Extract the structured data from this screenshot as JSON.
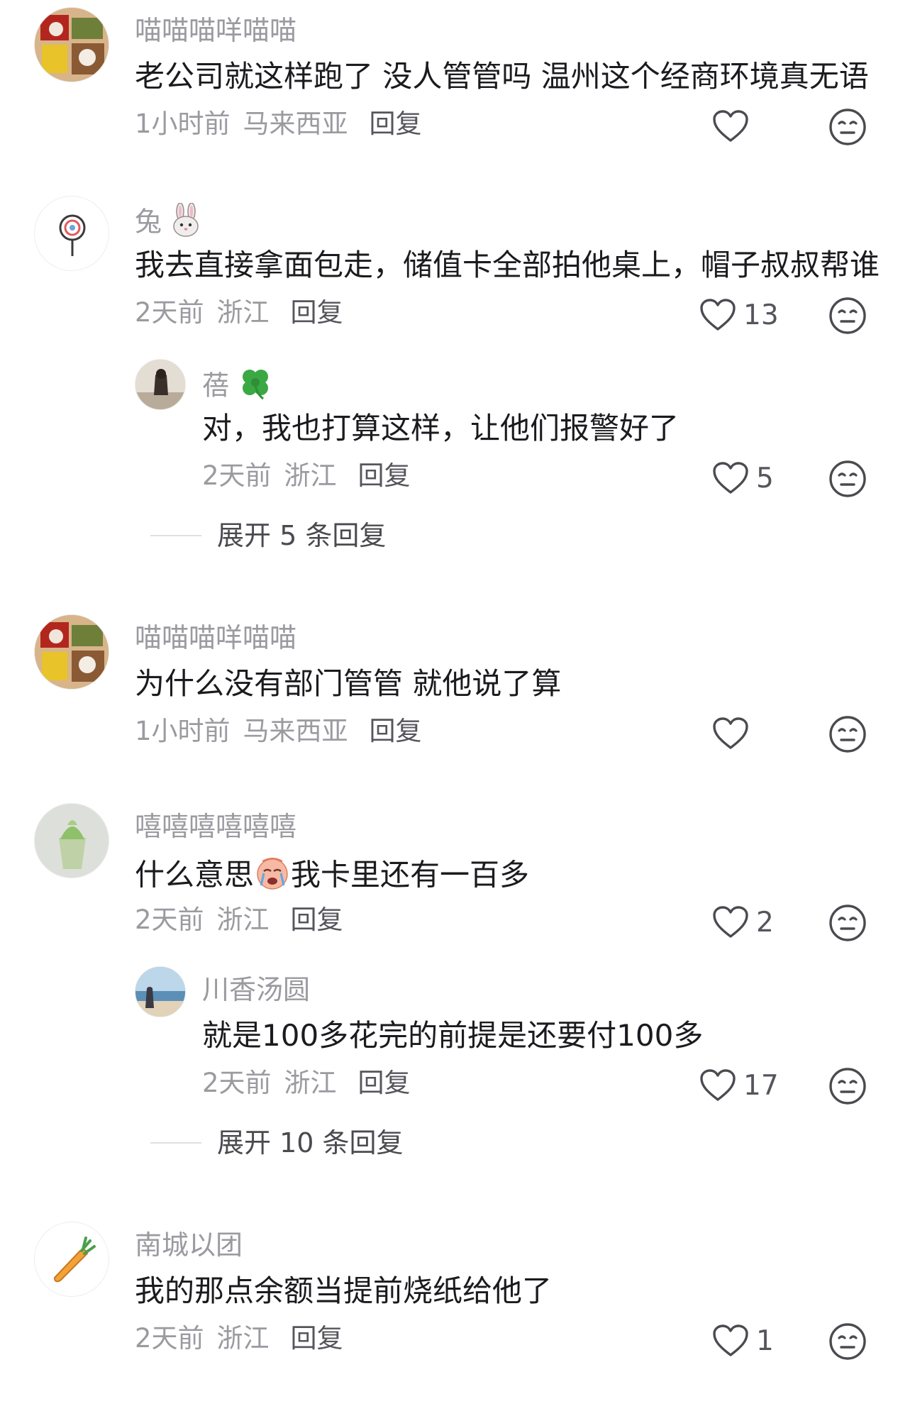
{
  "comments": [
    {
      "username": "喵喵喵咩喵喵",
      "content": "老公司就这样跑了 没人管管吗 温州这个经商环境真无语",
      "time": "1小时前",
      "location": "马来西亚",
      "reply_label": "回复",
      "likes": ""
    },
    {
      "username": "兔",
      "username_icon": "rabbit-face-icon",
      "content": "我去直接拿面包走，储值卡全部拍他桌上，帽子叔叔帮谁",
      "time": "2天前",
      "location": "浙江",
      "reply_label": "回复",
      "likes": "13",
      "replies": [
        {
          "username": "蓓",
          "username_icon": "four-leaf-clover-icon",
          "content": "对，我也打算这样，让他们报警好了",
          "time": "2天前",
          "location": "浙江",
          "reply_label": "回复",
          "likes": "5"
        }
      ],
      "expand_label": "展开 5 条回复"
    },
    {
      "username": "喵喵喵咩喵喵",
      "content": "为什么没有部门管管 就他说了算",
      "time": "1小时前",
      "location": "马来西亚",
      "reply_label": "回复",
      "likes": ""
    },
    {
      "username": "嘻嘻嘻嘻嘻嘻",
      "content_before": "什么意思",
      "content_emoji": "crying-face-icon",
      "content_after": "我卡里还有一百多",
      "time": "2天前",
      "location": "浙江",
      "reply_label": "回复",
      "likes": "2",
      "replies": [
        {
          "username": "川香汤圆",
          "content": "就是100多花完的前提是还要付100多",
          "time": "2天前",
          "location": "浙江",
          "reply_label": "回复",
          "likes": "17"
        }
      ],
      "expand_label": "展开 10 条回复"
    },
    {
      "username": "南城以团",
      "content": "我的那点余额当提前烧纸给他了",
      "time": "2天前",
      "location": "浙江",
      "reply_label": "回复",
      "likes": "1"
    }
  ],
  "colors": {
    "username": "#9a9aa0",
    "content": "#1b1b1f",
    "meta": "#9a9aa0",
    "icon": "#4a4a50"
  }
}
